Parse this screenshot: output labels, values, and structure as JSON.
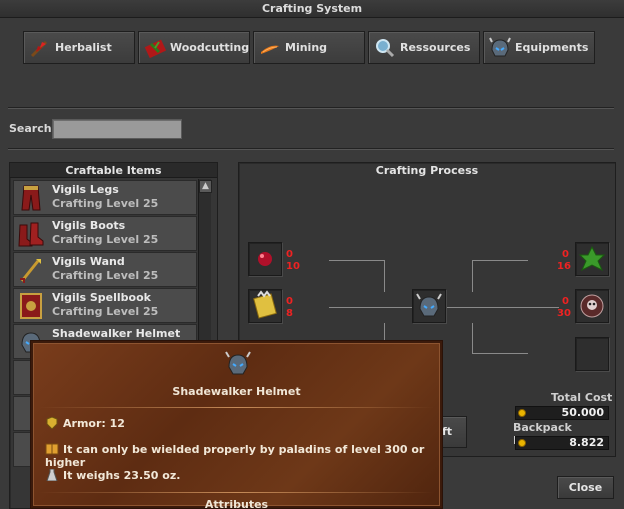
{
  "window": {
    "title": "Crafting System"
  },
  "categories": [
    {
      "label": "Herbalist",
      "icon": "herb-icon"
    },
    {
      "label": "Woodcutting",
      "icon": "axe-icon"
    },
    {
      "label": "Mining",
      "icon": "pickaxe-icon"
    },
    {
      "label": "Ressources",
      "icon": "magnifier-icon"
    },
    {
      "label": "Equipments",
      "icon": "helmet-icon"
    }
  ],
  "search": {
    "label": "Search",
    "value": ""
  },
  "craftable": {
    "title": "Craftable Items",
    "items": [
      {
        "name": "Vigils Legs",
        "level": "Crafting Level 25"
      },
      {
        "name": "Vigils Boots",
        "level": "Crafting Level 25"
      },
      {
        "name": "Vigils Wand",
        "level": "Crafting Level 25"
      },
      {
        "name": "Vigils Spellbook",
        "level": "Crafting Level 25"
      },
      {
        "name": "Shadewalker Helmet",
        "level": ""
      }
    ]
  },
  "process": {
    "title": "Crafting Process",
    "ingredients": [
      {
        "have": "0",
        "need": "10",
        "icon": "red-orb-icon"
      },
      {
        "have": "0",
        "need": "8",
        "icon": "scroll-icon"
      },
      {
        "have": "0",
        "need": "16",
        "icon": "leaf-icon"
      },
      {
        "have": "0",
        "need": "30",
        "icon": "skull-icon"
      }
    ],
    "result_icon": "helmet-icon",
    "total_cost_label": "Total Cost",
    "total_cost": "50.000",
    "backpack_label": "Backpack Money",
    "backpack": "8.822",
    "craft_button_partial": "ft"
  },
  "close_label": "Close",
  "tooltip": {
    "name": "Shadewalker Helmet",
    "armor": "Armor: 12",
    "wield": "It can only be wielded properly by paladins of level 300 or higher",
    "weight": "It weighs 23.50 oz.",
    "attributes": "Attributes"
  },
  "colors": {
    "background": "#3a3a3a",
    "counter_red": "#ee2222",
    "tooltip_brown": "#6a3417",
    "coin_gold": "#e8b400"
  }
}
